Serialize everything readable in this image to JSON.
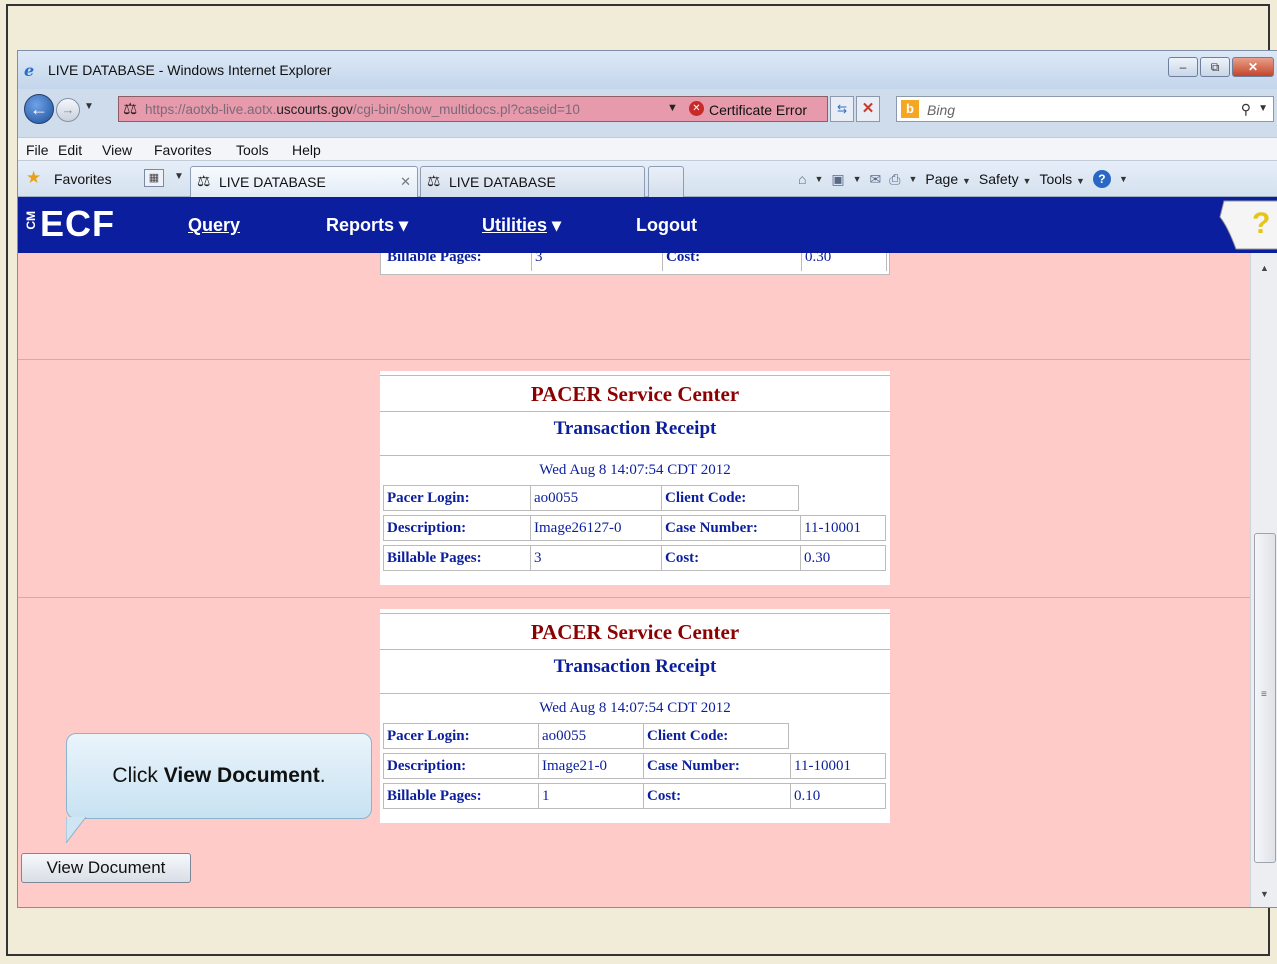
{
  "browser": {
    "window_title": "LIVE DATABASE - Windows Internet Explorer",
    "address_url_prefix": "https://aotxb-live.aotx.",
    "address_url_domain": "uscourts.gov",
    "address_url_suffix": "/cgi-bin/show_multidocs.pl?caseid=10",
    "certificate_error": "Certificate Error",
    "search_placeholder": "Bing",
    "menu": [
      "File",
      "Edit",
      "View",
      "Favorites",
      "Tools",
      "Help"
    ],
    "favorites_label": "Favorites",
    "tabs": [
      {
        "label": "LIVE DATABASE",
        "active": true
      },
      {
        "label": "LIVE DATABASE",
        "active": false
      }
    ],
    "command_bar": {
      "page": "Page",
      "safety": "Safety",
      "tools": "Tools"
    }
  },
  "ecf": {
    "logo": "ECF",
    "logo_prefix": "CM",
    "menu": {
      "query": "Query",
      "reports": "Reports",
      "utilities": "Utilities",
      "logout": "Logout"
    },
    "help_glyph": "?"
  },
  "partial_receipt": {
    "billable_label": "Billable Pages:",
    "billable_value": "3",
    "cost_label": "Cost:",
    "cost_value": "0.30"
  },
  "receipts": [
    {
      "header": "PACER Service Center",
      "subheader": "Transaction Receipt",
      "date": "Wed Aug 8 14:07:54 CDT 2012",
      "pacer_login_label": "Pacer Login:",
      "pacer_login": "ao0055",
      "client_code_label": "Client Code:",
      "client_code": "",
      "description_label": "Description:",
      "description": "Image26127-0",
      "case_number_label": "Case Number:",
      "case_number": "11-10001",
      "billable_pages_label": "Billable Pages:",
      "billable_pages": "3",
      "cost_label": "Cost:",
      "cost": "0.30"
    },
    {
      "header": "PACER Service Center",
      "subheader": "Transaction Receipt",
      "date": "Wed Aug 8 14:07:54 CDT 2012",
      "pacer_login_label": "Pacer Login:",
      "pacer_login": "ao0055",
      "client_code_label": "Client Code:",
      "client_code": "",
      "description_label": "Description:",
      "description": "Image21-0",
      "case_number_label": "Case Number:",
      "case_number": "11-10001",
      "billable_pages_label": "Billable Pages:",
      "billable_pages": "1",
      "cost_label": "Cost:",
      "cost": "0.10"
    }
  ],
  "callout": {
    "prefix": "Click ",
    "emphasis": "View Document",
    "suffix": "."
  },
  "view_document_button": "View Document",
  "colors": {
    "ecf_header": "#0b1f9e",
    "content_bg": "#fecbc9",
    "receipt_title": "#8b0000",
    "receipt_text": "#0b1f9e"
  }
}
